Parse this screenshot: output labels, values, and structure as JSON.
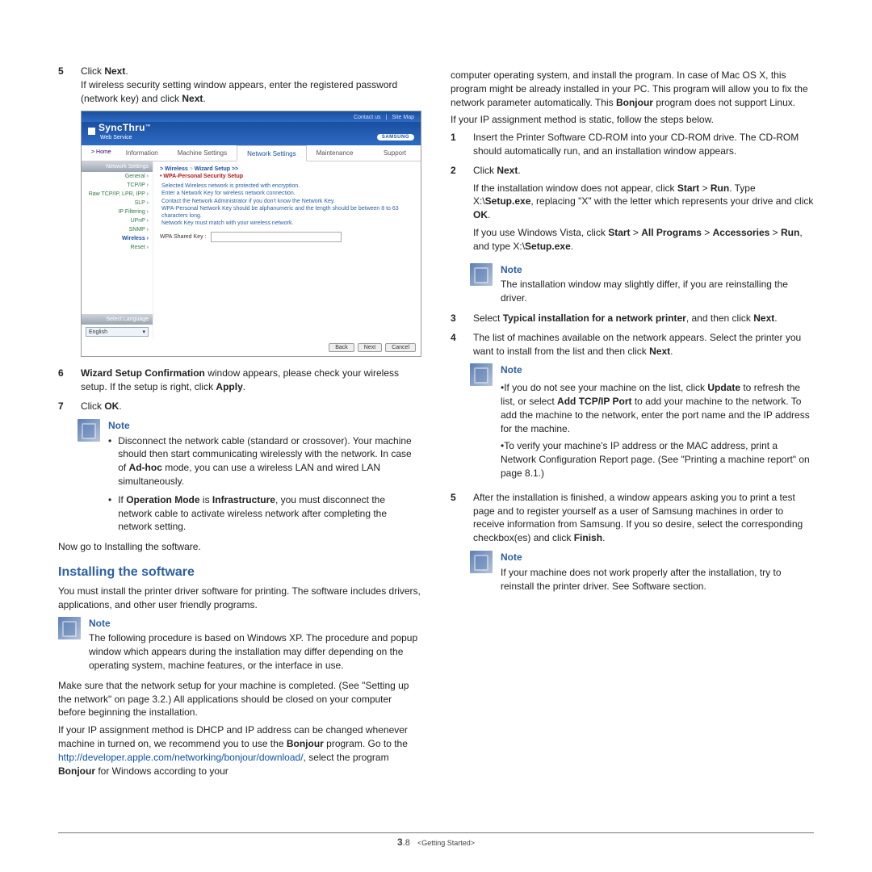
{
  "left": {
    "step5": {
      "num": "5",
      "line1": "Click ",
      "bold1": "Next",
      "line1b": ".",
      "line2": "If wireless security setting window appears, enter the registered password (network key) and click  ",
      "bold2": "Next",
      "line2b": "."
    },
    "shot": {
      "top": {
        "contact": "Contact us",
        "pipe": "|",
        "sitemap": "Site Map"
      },
      "logo": {
        "name": "SyncThru",
        "tm": "™",
        "sub": "Web Service"
      },
      "brand": "SAMSUNG",
      "tabs": {
        "home": "> Home",
        "info": "Information",
        "mset": "Machine Settings",
        "nset": "Network Settings",
        "maint": "Maintenance",
        "support": "Support"
      },
      "side": {
        "head": "Network Settings",
        "items": [
          "General ›",
          "TCP/IP ›",
          "Raw TCP/IP, LPR, IPP ›",
          "SLP ›",
          "IP Filtering ›",
          "UPnP ›",
          "SNMP ›",
          "Wireless ›",
          "Reset ›"
        ],
        "activeIndex": 7,
        "langHead": "Select Language",
        "lang": "English"
      },
      "main": {
        "crumb_w": "> Wireless",
        "crumb_sep": " > ",
        "crumb_s": "Wizard Setup >>",
        "title": "• WPA-Personal Security Setup",
        "l1": "Selected Wireless network is protected with encryption.",
        "l2": "Enter a Network Key for wireless network connection.",
        "l3": "Contact the Network Administrator if you don't know the Network Key.",
        "l4": "WPA-Personal Network Key should be alphanumeric and the length should be between 8 to 63 characters long.",
        "l5": "Network Key must match with your wireless network.",
        "field": "WPA Shared Key :"
      },
      "buttons": {
        "back": "Back",
        "next": "Next",
        "cancel": "Cancel"
      }
    },
    "step6": {
      "num": "6",
      "pre": "",
      "bold": "Wizard Setup Confirmation",
      "post": " window appears, please check your wireless setup. If the setup is right, click ",
      "bold2": "Apply",
      "post2": "."
    },
    "step7": {
      "num": "7",
      "line": "Click ",
      "bold": "OK",
      "post": "."
    },
    "note1": {
      "title": "Note",
      "b1a": "Disconnect the network cable (standard or crossover). Your machine should then start communicating wirelessly with the network. In case of ",
      "b1bold": "Ad-hoc",
      "b1b": " mode, you can use a wireless LAN and wired LAN simultaneously.",
      "b2a": "If ",
      "b2bold1": "Operation Mode",
      "b2b": " is ",
      "b2bold2": "Infrastructure",
      "b2c": ", you must disconnect the network cable to activate wireless network after completing the network setting."
    },
    "nowgo": "Now go to Installing the software.",
    "section": "Installing the software",
    "intro": "You must install the printer driver software for printing. The software includes drivers, applications, and other user friendly programs.",
    "note2": {
      "title": "Note",
      "body": "The following procedure is based on Windows XP. The procedure and popup window which appears during the installation may differ depending on the operating system, machine features, or the interface in use."
    },
    "p1": "Make sure that the network setup for your machine is completed. (See \"Setting up the network\" on page 3.2.) All applications should be closed on your computer before beginning the installation.",
    "p2a": "If your IP assignment method is DHCP and IP address can be changed whenever machine in turned on, we recommend you to use the ",
    "p2bold": "Bonjour",
    "p2b": " program. Go to the ",
    "p2url": "http://developer.apple.com/networking/bonjour/download/",
    "p2c": ", select the program ",
    "p2bold2": "Bonjour",
    "p2d": " for Windows according to your "
  },
  "right": {
    "cont": "computer operating system, and install the program. In case of Mac OS X, this program might be already installed in your PC. This program will allow you to fix the network parameter automatically. This ",
    "contBold": "Bonjour",
    "cont2": " program does not support Linux.",
    "pstatic": "If your IP assignment method is static, follow the steps below.",
    "s1": {
      "num": "1",
      "t": "Insert the Printer Software CD-ROM into your CD-ROM drive. The CD-ROM should automatically run, and an installation window appears."
    },
    "s2": {
      "num": "2",
      "l1": "Click ",
      "b1": "Next",
      "l1b": ".",
      "l2a": "If the installation window does not appear, click ",
      "b2": "Start",
      "gt": " > ",
      "b3": "Run",
      "l2b": ". Type X:\\",
      "b4": "Setup.exe",
      "l2c": ", replacing \"X\" with the letter which represents your drive and click ",
      "b5": "OK",
      "l2d": ".",
      "l3a": "If you use Windows Vista, click ",
      "b6": "Start",
      "gt2": " > ",
      "b7": "All Programs",
      "gt3": " > ",
      "b8": "Accessories",
      "gt4": " > ",
      "b9": "Run",
      "l3b": ", and type X:\\",
      "b10": "Setup.exe",
      "l3c": "."
    },
    "note3": {
      "title": "Note",
      "body": "The installation window may slightly differ, if you are reinstalling the driver."
    },
    "s3": {
      "num": "3",
      "a": "Select ",
      "bold": "Typical installation for a network printer",
      "b": ", and then click ",
      "bold2": "Next",
      "c": "."
    },
    "s4": {
      "num": "4",
      "a": "The list of machines available on the network appears. Select the printer you want to install from the list and then click ",
      "bold": "Next",
      "b": "."
    },
    "note4": {
      "title": "Note",
      "p1a": "•If you do not see your machine on the list, click ",
      "b1": "Update",
      "p1b": " to refresh the list, or select ",
      "b2": "Add TCP/IP Port",
      "p1c": " to add your machine to the network. To add the machine to the network, enter the port name and the IP address for the machine.",
      "p2": "•To verify your machine's IP address or the MAC address, print a Network Configuration Report page. (See \"Printing a machine report\" on page 8.1.)"
    },
    "s5": {
      "num": "5",
      "a": "After the installation is finished, a window appears asking you to print a test page and to register yourself as a user of Samsung machines in order to receive information from Samsung. If you so desire, select the corresponding checkbox(es) and click ",
      "bold": "Finish",
      "b": "."
    },
    "note5": {
      "title": "Note",
      "body": "If your machine does not work properly after the installation, try to reinstall the printer driver. See Software section."
    }
  },
  "footer": {
    "num": "3",
    "dot": ".",
    "num2": "8",
    "label": "<Getting Started>"
  }
}
